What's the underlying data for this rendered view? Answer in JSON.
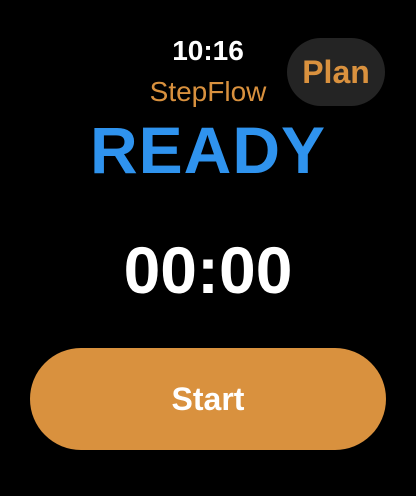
{
  "header": {
    "time": "10:16",
    "app_name": "StepFlow",
    "plan_label": "Plan"
  },
  "main": {
    "status": "READY",
    "timer": "00:00",
    "start_label": "Start"
  },
  "colors": {
    "background": "#000000",
    "accent": "#d9913e",
    "status": "#2f93ee",
    "button_dark": "#242424",
    "text": "#ffffff"
  }
}
